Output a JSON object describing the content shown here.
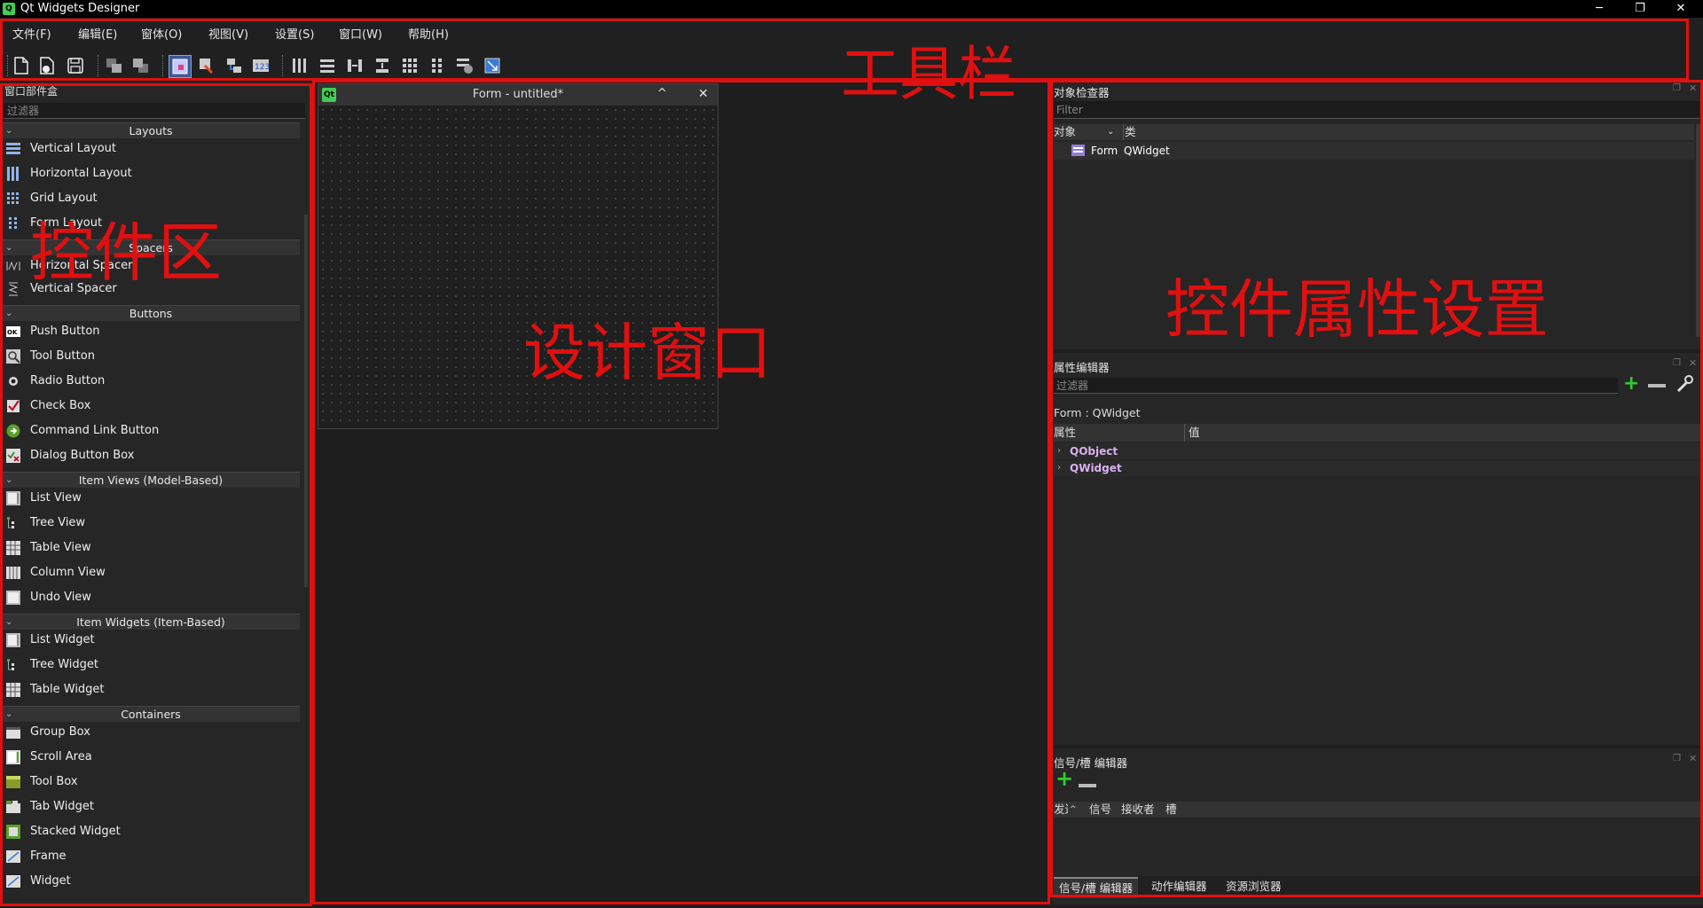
{
  "window": {
    "title": "Qt Widgets Designer",
    "app_icon": "qt-logo-icon",
    "minimize": "─",
    "restore": "❐",
    "close": "✕"
  },
  "menubar": [
    {
      "label": "文件(F)"
    },
    {
      "label": "编辑(E)"
    },
    {
      "label": "窗体(O)"
    },
    {
      "label": "视图(V)"
    },
    {
      "label": "设置(S)"
    },
    {
      "label": "窗口(W)"
    },
    {
      "label": "帮助(H)"
    }
  ],
  "widget_box": {
    "title": "窗口部件盒",
    "filter_placeholder": "过滤器",
    "categories": [
      {
        "name": "Layouts",
        "items": [
          "Vertical Layout",
          "Horizontal Layout",
          "Grid Layout",
          "Form Layout"
        ]
      },
      {
        "name": "Spacers",
        "items": [
          "Horizontal Spacer",
          "Vertical Spacer"
        ]
      },
      {
        "name": "Buttons",
        "items": [
          "Push Button",
          "Tool Button",
          "Radio Button",
          "Check Box",
          "Command Link Button",
          "Dialog Button Box"
        ]
      },
      {
        "name": "Item Views (Model-Based)",
        "items": [
          "List View",
          "Tree View",
          "Table View",
          "Column View",
          "Undo View"
        ]
      },
      {
        "name": "Item Widgets (Item-Based)",
        "items": [
          "List Widget",
          "Tree Widget",
          "Table Widget"
        ]
      },
      {
        "name": "Containers",
        "items": [
          "Group Box",
          "Scroll Area",
          "Tool Box",
          "Tab Widget",
          "Stacked Widget",
          "Frame",
          "Widget"
        ]
      }
    ]
  },
  "form_window": {
    "title": "Form - untitled*",
    "icon": "Qt",
    "collapse": "^",
    "close": "✕"
  },
  "object_inspector": {
    "title": "对象检查器",
    "filter_placeholder": "Filter",
    "col_object": "对象",
    "col_class": "类",
    "row_object": "Form",
    "row_class": "QWidget"
  },
  "property_editor": {
    "title": "属性编辑器",
    "filter_placeholder": "过滤器",
    "context": "Form : QWidget",
    "col_property": "属性",
    "col_value": "值",
    "groups": [
      "QObject",
      "QWidget"
    ]
  },
  "signal_slot_editor": {
    "title": "信号/槽 编辑器",
    "col_sender": "发送",
    "col_signal": "信号",
    "col_receiver": "接收者",
    "col_slot": "槽"
  },
  "bottom_tabs": [
    "信号/槽 编辑器",
    "动作编辑器",
    "资源浏览器"
  ],
  "annotations": {
    "toolbar": "工具栏",
    "widget_area": "控件区",
    "design_window": "设计窗口",
    "property_settings": "控件属性设置",
    "color": "#e01010"
  }
}
